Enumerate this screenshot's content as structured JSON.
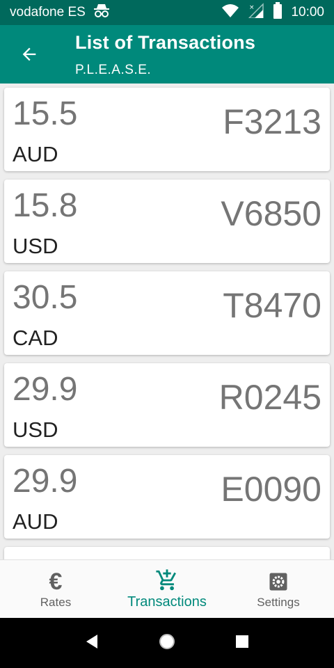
{
  "status_bar": {
    "carrier": "vodafone ES",
    "time": "10:00",
    "icons": [
      "incognito-icon",
      "wifi-icon",
      "signal-icon",
      "battery-icon"
    ]
  },
  "app_bar": {
    "title": "List of Transactions",
    "subtitle": "P.L.E.A.S.E.",
    "color": "#00897b",
    "status_color": "#00695c"
  },
  "transactions": [
    {
      "amount": "15.5",
      "currency": "AUD",
      "code": "F3213"
    },
    {
      "amount": "15.8",
      "currency": "USD",
      "code": "V6850"
    },
    {
      "amount": "30.5",
      "currency": "CAD",
      "code": "T8470"
    },
    {
      "amount": "29.9",
      "currency": "USD",
      "code": "R0245"
    },
    {
      "amount": "29.9",
      "currency": "AUD",
      "code": "E0090"
    }
  ],
  "bottom_nav": {
    "items": [
      {
        "label": "Rates",
        "icon": "euro-icon",
        "active": false
      },
      {
        "label": "Transactions",
        "icon": "cart-add-icon",
        "active": true
      },
      {
        "label": "Settings",
        "icon": "gear-icon",
        "active": false
      }
    ],
    "active_color": "#00897b"
  },
  "system_nav": [
    "back-icon",
    "home-icon",
    "recents-icon"
  ]
}
